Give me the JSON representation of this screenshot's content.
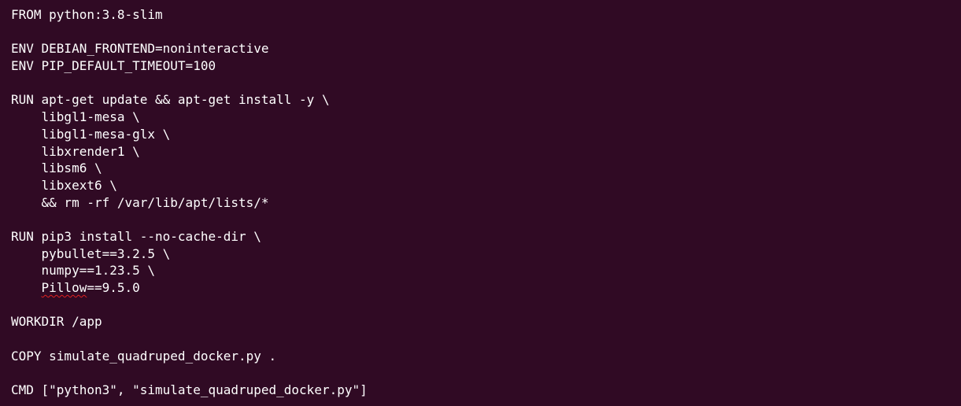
{
  "colors": {
    "background": "#300a24",
    "text": "#ffffff",
    "spellcheck_underline": "#e02020"
  },
  "editor": {
    "lines": [
      {
        "text": "FROM python:3.8-slim"
      },
      {
        "text": ""
      },
      {
        "text": "ENV DEBIAN_FRONTEND=noninteractive"
      },
      {
        "text": "ENV PIP_DEFAULT_TIMEOUT=100"
      },
      {
        "text": ""
      },
      {
        "text": "RUN apt-get update && apt-get install -y \\"
      },
      {
        "text": "    libgl1-mesa \\"
      },
      {
        "text": "    libgl1-mesa-glx \\"
      },
      {
        "text": "    libxrender1 \\"
      },
      {
        "text": "    libsm6 \\"
      },
      {
        "text": "    libxext6 \\"
      },
      {
        "text": "    && rm -rf /var/lib/apt/lists/*"
      },
      {
        "text": ""
      },
      {
        "text": "RUN pip3 install --no-cache-dir \\"
      },
      {
        "text": "    pybullet==3.2.5 \\"
      },
      {
        "text": "    numpy==1.23.5 \\"
      },
      {
        "indent": "    ",
        "misspelled": "Pillow",
        "rest": "==9.5.0"
      },
      {
        "text": ""
      },
      {
        "text": "WORKDIR /app"
      },
      {
        "text": ""
      },
      {
        "text": "COPY simulate_quadruped_docker.py ."
      },
      {
        "text": ""
      },
      {
        "text": "CMD [\"python3\", \"simulate_quadruped_docker.py\"]"
      }
    ]
  }
}
